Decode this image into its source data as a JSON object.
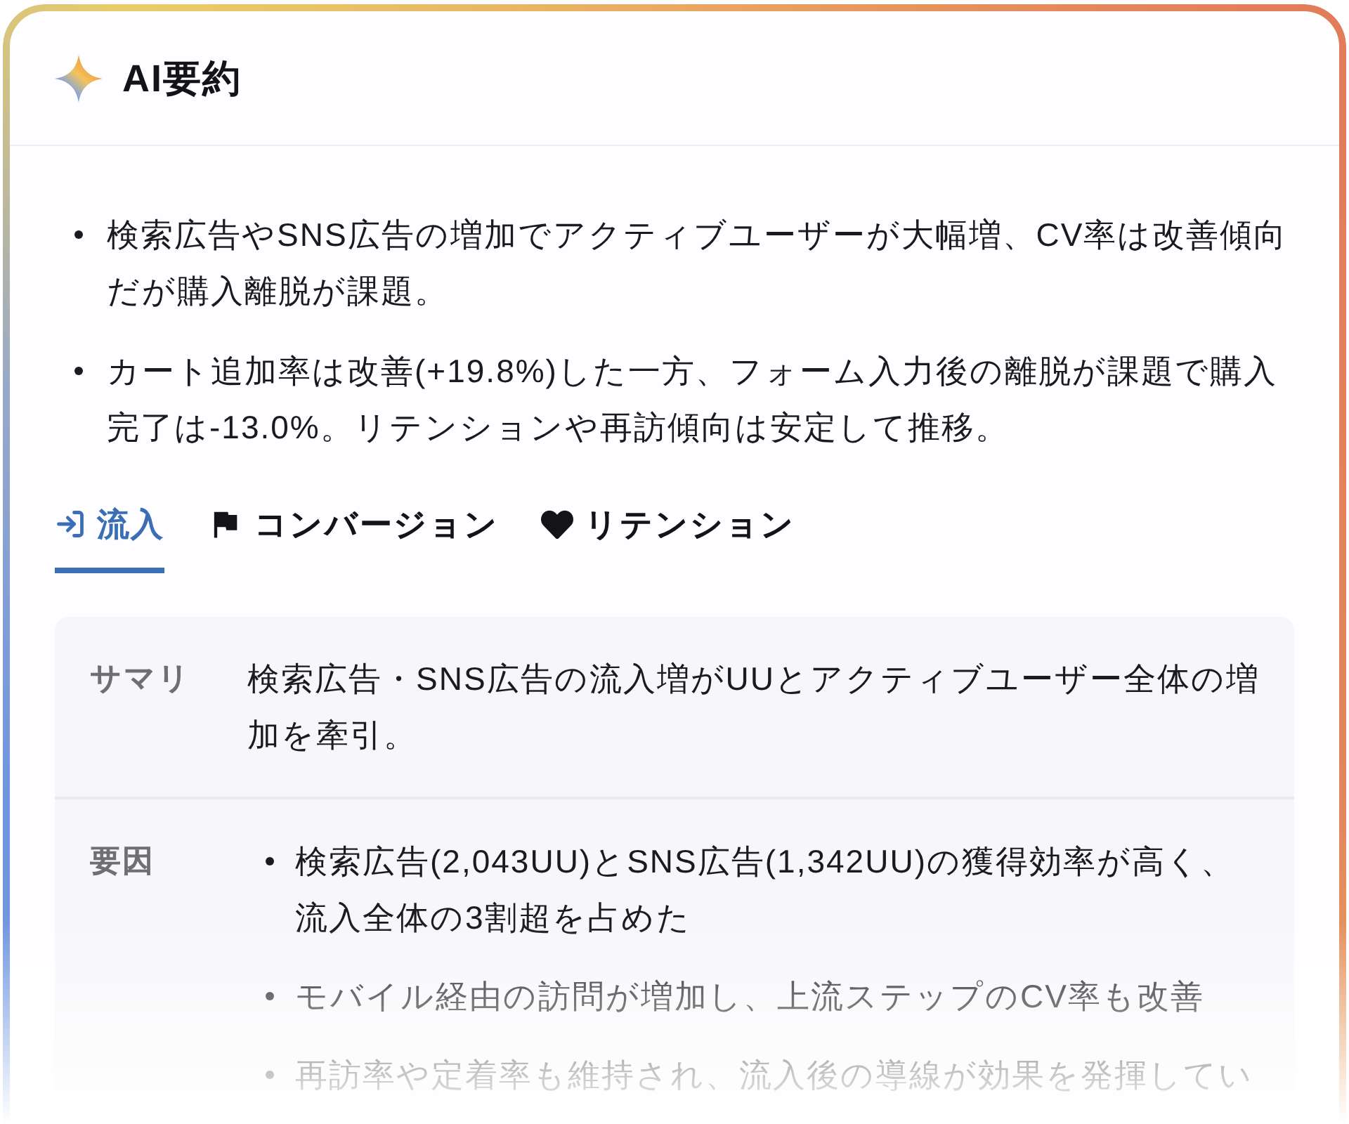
{
  "card": {
    "title": "AI要約"
  },
  "summary_points": [
    "検索広告やSNS広告の増加でアクティブユーザーが大幅増、CV率は改善傾向だが購入離脱が課題。",
    "カート追加率は改善(+19.8%)した一方、フォーム入力後の離脱が課題で購入完了は-13.0%。リテンションや再訪傾向は安定して推移。"
  ],
  "tabs": [
    {
      "label": "流入",
      "selected": true
    },
    {
      "label": "コンバージョン",
      "selected": false
    },
    {
      "label": "リテンション",
      "selected": false
    }
  ],
  "detail": {
    "rows": [
      {
        "kind": "text",
        "label": "サマリ",
        "text": "検索広告・SNS広告の流入増がUUとアクティブユーザー全体の増加を牽引。"
      },
      {
        "kind": "list",
        "label": "要因",
        "items": [
          "検索広告(2,043UU)とSNS広告(1,342UU)の獲得効率が高く、流入全体の3割超を占めた",
          "モバイル経由の訪問が増加し、上流ステップのCV率も改善",
          "再訪率や定着率も維持され、流入後の導線が効果を発揮してい"
        ]
      }
    ]
  }
}
